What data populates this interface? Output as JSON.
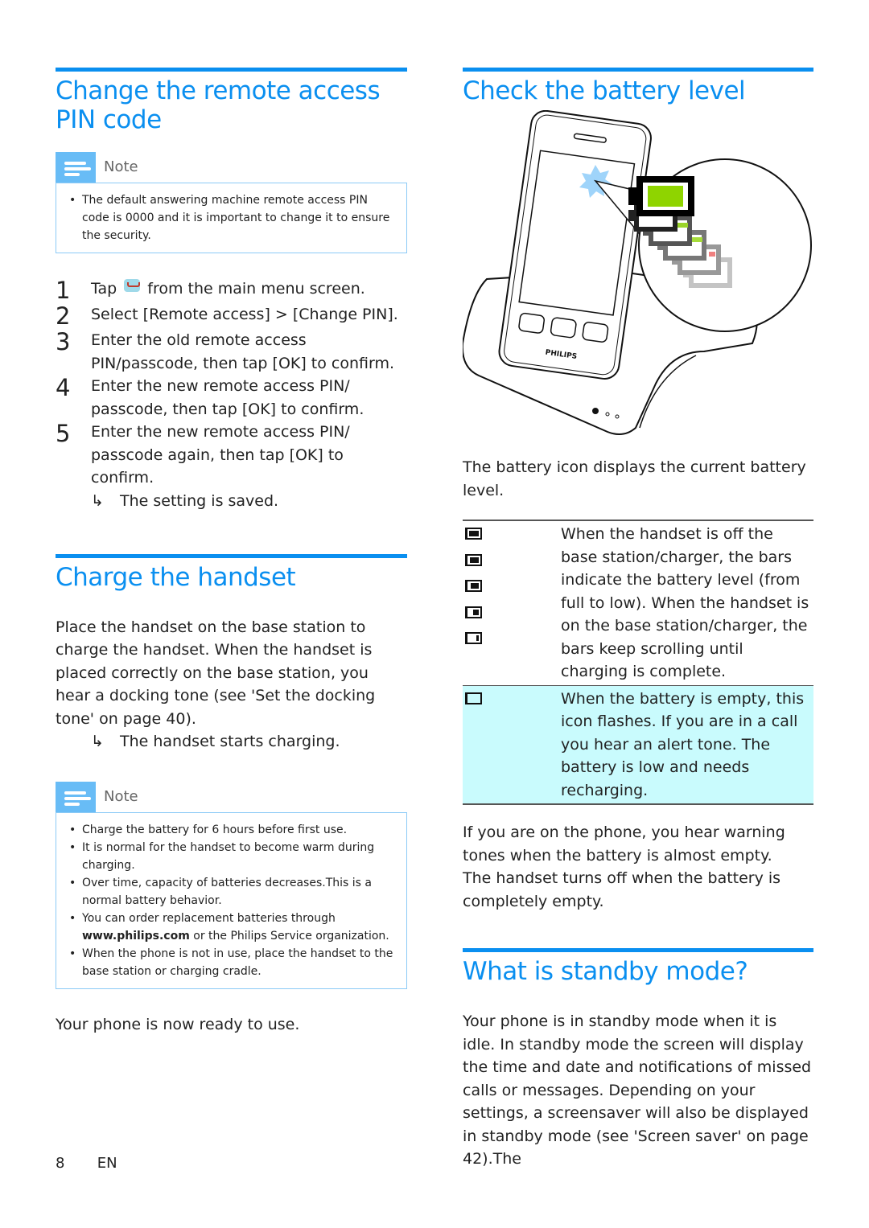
{
  "left": {
    "remote_pin": {
      "title": "Change the remote access PIN code",
      "note_label": "Note",
      "note_items": [
        "The default answering machine remote access PIN code is 0000 and it is important to change it to ensure the security."
      ],
      "steps": [
        {
          "num": "1",
          "pre": "Tap",
          "icon": "voicemail-icon",
          "post": "from the main menu screen."
        },
        {
          "num": "2",
          "text": "Select [Remote access] > [Change PIN]."
        },
        {
          "num": "3",
          "text": "Enter the old remote access PIN/passcode, then tap [OK] to confirm."
        },
        {
          "num": "4",
          "text": "Enter the new remote access PIN/ passcode, then tap [OK] to confirm."
        },
        {
          "num": "5",
          "text": "Enter the new remote access PIN/ passcode again, then tap [OK] to confirm."
        }
      ],
      "result_arrow": "↳",
      "result": "The setting is saved."
    },
    "charge": {
      "title": "Charge the handset",
      "body": "Place the handset on the base station to charge the handset. When the handset is placed correctly on the base station, you hear a docking tone (see 'Set the docking tone' on page 40).",
      "result_arrow": "↳",
      "result": "The handset starts charging.",
      "note_label": "Note",
      "note_items": [
        {
          "text": "Charge the battery for 6 hours before first use."
        },
        {
          "text": "It is normal for the handset to become warm during charging."
        },
        {
          "text": "Over time, capacity of batteries decreases.This is a normal battery behavior."
        },
        {
          "pre": "You can order replacement batteries through ",
          "bold": "www.philips.com",
          "post": " or the Philips Service organization."
        },
        {
          "text": "When the phone is not in use, place the handset to the base station or charging cradle."
        }
      ],
      "ready": "Your phone is now ready to use."
    }
  },
  "right": {
    "battery": {
      "title": "Check the battery level",
      "illustration": {
        "brand": "PHILIPS",
        "levels_shown": 5,
        "accent_green": "#8fd400",
        "low_red": "#f08080",
        "flash_blue": "#9fd4fa"
      },
      "intro": "The battery icon displays the current battery level.",
      "table": [
        {
          "icons": [
            1.0,
            0.75,
            0.5,
            0.25,
            0.0
          ],
          "desc": "When the handset is off the base station/charger, the bars indicate the battery level (from full to low). When the handset is on the base station/charger, the bars keep scrolling until charging is complete.",
          "highlight": false
        },
        {
          "icons": [
            0.0
          ],
          "desc": "When the battery is empty, this icon flashes. If you are in a call you hear an alert tone. The battery is low and needs recharging.",
          "highlight": true
        }
      ],
      "after1": "If you are on the phone, you hear warning tones when the battery is almost empty.",
      "after2": "The handset turns off when the battery is completely empty."
    },
    "standby": {
      "title": "What is standby mode?",
      "body": "Your phone is in standby mode when it is idle. In standby mode the screen will display the time and date and notifications of missed calls or messages. Depending on your settings, a screensaver will also be displayed in standby mode (see 'Screen saver' on page 42).The"
    }
  },
  "footer": {
    "page": "8",
    "lang": "EN"
  },
  "colors": {
    "heading": "#0a8ff0",
    "note_icon": "#68bcf6",
    "note_border": "#8ccaf6",
    "highlight_row": "#c9fbfd"
  }
}
